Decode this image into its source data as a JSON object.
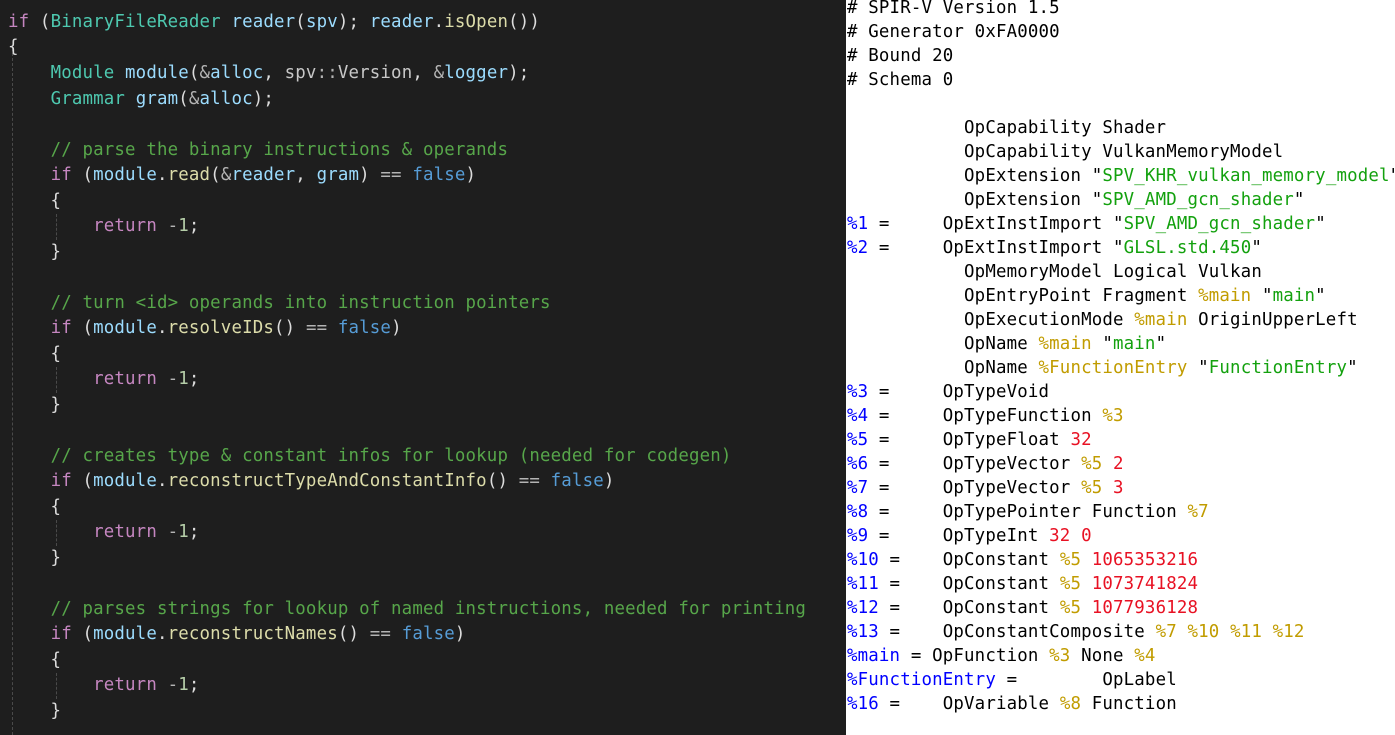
{
  "code_lines": [
    [
      {
        "t": "if",
        "c": "ct"
      },
      {
        "t": " (",
        "c": "pu"
      },
      {
        "t": "BinaryFileReader",
        "c": "ty"
      },
      {
        "t": " ",
        "c": "pu"
      },
      {
        "t": "reader",
        "c": "va"
      },
      {
        "t": "(",
        "c": "pu"
      },
      {
        "t": "spv",
        "c": "va"
      },
      {
        "t": "); ",
        "c": "pu"
      },
      {
        "t": "reader",
        "c": "va"
      },
      {
        "t": ".",
        "c": "pu"
      },
      {
        "t": "isOpen",
        "c": "fn"
      },
      {
        "t": "())",
        "c": "pu"
      }
    ],
    [
      {
        "t": "{",
        "c": "pu"
      }
    ],
    [
      {
        "t": "    ",
        "c": "pu"
      },
      {
        "t": "Module",
        "c": "ty"
      },
      {
        "t": " ",
        "c": "pu"
      },
      {
        "t": "module",
        "c": "va"
      },
      {
        "t": "(",
        "c": "pu"
      },
      {
        "t": "&",
        "c": "op"
      },
      {
        "t": "alloc",
        "c": "va"
      },
      {
        "t": ", ",
        "c": "pu"
      },
      {
        "t": "spv",
        "c": "ns"
      },
      {
        "t": "::",
        "c": "op"
      },
      {
        "t": "Version",
        "c": "ns"
      },
      {
        "t": ", ",
        "c": "pu"
      },
      {
        "t": "&",
        "c": "op"
      },
      {
        "t": "logger",
        "c": "va"
      },
      {
        "t": ");",
        "c": "pu"
      }
    ],
    [
      {
        "t": "    ",
        "c": "pu"
      },
      {
        "t": "Grammar",
        "c": "ty"
      },
      {
        "t": " ",
        "c": "pu"
      },
      {
        "t": "gram",
        "c": "va"
      },
      {
        "t": "(",
        "c": "pu"
      },
      {
        "t": "&",
        "c": "op"
      },
      {
        "t": "alloc",
        "c": "va"
      },
      {
        "t": ");",
        "c": "pu"
      }
    ],
    [],
    [
      {
        "t": "    ",
        "c": "pu"
      },
      {
        "t": "// parse the binary instructions & operands",
        "c": "cm"
      }
    ],
    [
      {
        "t": "    ",
        "c": "pu"
      },
      {
        "t": "if",
        "c": "ct"
      },
      {
        "t": " (",
        "c": "pu"
      },
      {
        "t": "module",
        "c": "va"
      },
      {
        "t": ".",
        "c": "pu"
      },
      {
        "t": "read",
        "c": "fn"
      },
      {
        "t": "(",
        "c": "pu"
      },
      {
        "t": "&",
        "c": "op"
      },
      {
        "t": "reader",
        "c": "va"
      },
      {
        "t": ", ",
        "c": "pu"
      },
      {
        "t": "gram",
        "c": "va"
      },
      {
        "t": ") ",
        "c": "pu"
      },
      {
        "t": "==",
        "c": "op"
      },
      {
        "t": " ",
        "c": "pu"
      },
      {
        "t": "false",
        "c": "kw"
      },
      {
        "t": ")",
        "c": "pu"
      }
    ],
    [
      {
        "t": "    {",
        "c": "pu"
      }
    ],
    [
      {
        "t": "        ",
        "c": "pu"
      },
      {
        "t": "return",
        "c": "ct"
      },
      {
        "t": " ",
        "c": "pu"
      },
      {
        "t": "-",
        "c": "op"
      },
      {
        "t": "1",
        "c": "nu"
      },
      {
        "t": ";",
        "c": "pu"
      }
    ],
    [
      {
        "t": "    }",
        "c": "pu"
      }
    ],
    [],
    [
      {
        "t": "    ",
        "c": "pu"
      },
      {
        "t": "// turn <id> operands into instruction pointers",
        "c": "cm"
      }
    ],
    [
      {
        "t": "    ",
        "c": "pu"
      },
      {
        "t": "if",
        "c": "ct"
      },
      {
        "t": " (",
        "c": "pu"
      },
      {
        "t": "module",
        "c": "va"
      },
      {
        "t": ".",
        "c": "pu"
      },
      {
        "t": "resolveIDs",
        "c": "fn"
      },
      {
        "t": "() ",
        "c": "pu"
      },
      {
        "t": "==",
        "c": "op"
      },
      {
        "t": " ",
        "c": "pu"
      },
      {
        "t": "false",
        "c": "kw"
      },
      {
        "t": ")",
        "c": "pu"
      }
    ],
    [
      {
        "t": "    {",
        "c": "pu"
      }
    ],
    [
      {
        "t": "        ",
        "c": "pu"
      },
      {
        "t": "return",
        "c": "ct"
      },
      {
        "t": " ",
        "c": "pu"
      },
      {
        "t": "-",
        "c": "op"
      },
      {
        "t": "1",
        "c": "nu"
      },
      {
        "t": ";",
        "c": "pu"
      }
    ],
    [
      {
        "t": "    }",
        "c": "pu"
      }
    ],
    [],
    [
      {
        "t": "    ",
        "c": "pu"
      },
      {
        "t": "// creates type & constant infos for lookup (needed for codegen)",
        "c": "cm"
      }
    ],
    [
      {
        "t": "    ",
        "c": "pu"
      },
      {
        "t": "if",
        "c": "ct"
      },
      {
        "t": " (",
        "c": "pu"
      },
      {
        "t": "module",
        "c": "va"
      },
      {
        "t": ".",
        "c": "pu"
      },
      {
        "t": "reconstructTypeAndConstantInfo",
        "c": "fn"
      },
      {
        "t": "() ",
        "c": "pu"
      },
      {
        "t": "==",
        "c": "op"
      },
      {
        "t": " ",
        "c": "pu"
      },
      {
        "t": "false",
        "c": "kw"
      },
      {
        "t": ")",
        "c": "pu"
      }
    ],
    [
      {
        "t": "    {",
        "c": "pu"
      }
    ],
    [
      {
        "t": "        ",
        "c": "pu"
      },
      {
        "t": "return",
        "c": "ct"
      },
      {
        "t": " ",
        "c": "pu"
      },
      {
        "t": "-",
        "c": "op"
      },
      {
        "t": "1",
        "c": "nu"
      },
      {
        "t": ";",
        "c": "pu"
      }
    ],
    [
      {
        "t": "    }",
        "c": "pu"
      }
    ],
    [],
    [
      {
        "t": "    ",
        "c": "pu"
      },
      {
        "t": "// parses strings for lookup of named instructions, needed for printing",
        "c": "cm"
      }
    ],
    [
      {
        "t": "    ",
        "c": "pu"
      },
      {
        "t": "if",
        "c": "ct"
      },
      {
        "t": " (",
        "c": "pu"
      },
      {
        "t": "module",
        "c": "va"
      },
      {
        "t": ".",
        "c": "pu"
      },
      {
        "t": "reconstructNames",
        "c": "fn"
      },
      {
        "t": "() ",
        "c": "pu"
      },
      {
        "t": "==",
        "c": "op"
      },
      {
        "t": " ",
        "c": "pu"
      },
      {
        "t": "false",
        "c": "kw"
      },
      {
        "t": ")",
        "c": "pu"
      }
    ],
    [
      {
        "t": "    {",
        "c": "pu"
      }
    ],
    [
      {
        "t": "        ",
        "c": "pu"
      },
      {
        "t": "return",
        "c": "ct"
      },
      {
        "t": " ",
        "c": "pu"
      },
      {
        "t": "-",
        "c": "op"
      },
      {
        "t": "1",
        "c": "nu"
      },
      {
        "t": ";",
        "c": "pu"
      }
    ],
    [
      {
        "t": "    }",
        "c": "pu"
      }
    ]
  ],
  "disasm_lines": [
    [
      {
        "t": "# SPIR-V Version 1.5"
      }
    ],
    [
      {
        "t": "# Generator 0xFA0000"
      }
    ],
    [
      {
        "t": "# Bound 20"
      }
    ],
    [
      {
        "t": "# Schema 0"
      }
    ],
    [],
    [
      {
        "t": "           OpCapability Shader"
      }
    ],
    [
      {
        "t": "           OpCapability VulkanMemoryModel"
      }
    ],
    [
      {
        "t": "           OpExtension \""
      },
      {
        "t": "SPV_KHR_vulkan_memory_model",
        "c": "str"
      },
      {
        "t": "\""
      }
    ],
    [
      {
        "t": "           OpExtension \""
      },
      {
        "t": "SPV_AMD_gcn_shader",
        "c": "str"
      },
      {
        "t": "\""
      }
    ],
    [
      {
        "t": "%1",
        "c": "res"
      },
      {
        "t": " =     OpExtInstImport \""
      },
      {
        "t": "SPV_AMD_gcn_shader",
        "c": "str"
      },
      {
        "t": "\""
      }
    ],
    [
      {
        "t": "%2",
        "c": "res"
      },
      {
        "t": " =     OpExtInstImport \""
      },
      {
        "t": "GLSL.std.450",
        "c": "str"
      },
      {
        "t": "\""
      }
    ],
    [
      {
        "t": "           OpMemoryModel Logical Vulkan"
      }
    ],
    [
      {
        "t": "           OpEntryPoint Fragment "
      },
      {
        "t": "%main",
        "c": "ref"
      },
      {
        "t": " \""
      },
      {
        "t": "main",
        "c": "str"
      },
      {
        "t": "\""
      }
    ],
    [
      {
        "t": "           OpExecutionMode "
      },
      {
        "t": "%main",
        "c": "ref"
      },
      {
        "t": " OriginUpperLeft"
      }
    ],
    [
      {
        "t": "           OpName "
      },
      {
        "t": "%main",
        "c": "ref"
      },
      {
        "t": " \""
      },
      {
        "t": "main",
        "c": "str"
      },
      {
        "t": "\""
      }
    ],
    [
      {
        "t": "           OpName "
      },
      {
        "t": "%FunctionEntry",
        "c": "ref"
      },
      {
        "t": " \""
      },
      {
        "t": "FunctionEntry",
        "c": "str"
      },
      {
        "t": "\""
      }
    ],
    [
      {
        "t": "%3",
        "c": "res"
      },
      {
        "t": " =     OpTypeVoid"
      }
    ],
    [
      {
        "t": "%4",
        "c": "res"
      },
      {
        "t": " =     OpTypeFunction "
      },
      {
        "t": "%3",
        "c": "ref"
      }
    ],
    [
      {
        "t": "%5",
        "c": "res"
      },
      {
        "t": " =     OpTypeFloat "
      },
      {
        "t": "32",
        "c": "num"
      }
    ],
    [
      {
        "t": "%6",
        "c": "res"
      },
      {
        "t": " =     OpTypeVector "
      },
      {
        "t": "%5",
        "c": "ref"
      },
      {
        "t": " "
      },
      {
        "t": "2",
        "c": "num"
      }
    ],
    [
      {
        "t": "%7",
        "c": "res"
      },
      {
        "t": " =     OpTypeVector "
      },
      {
        "t": "%5",
        "c": "ref"
      },
      {
        "t": " "
      },
      {
        "t": "3",
        "c": "num"
      }
    ],
    [
      {
        "t": "%8",
        "c": "res"
      },
      {
        "t": " =     OpTypePointer Function "
      },
      {
        "t": "%7",
        "c": "ref"
      }
    ],
    [
      {
        "t": "%9",
        "c": "res"
      },
      {
        "t": " =     OpTypeInt "
      },
      {
        "t": "32",
        "c": "num"
      },
      {
        "t": " "
      },
      {
        "t": "0",
        "c": "num"
      }
    ],
    [
      {
        "t": "%10",
        "c": "res"
      },
      {
        "t": " =    OpConstant "
      },
      {
        "t": "%5",
        "c": "ref"
      },
      {
        "t": " "
      },
      {
        "t": "1065353216",
        "c": "num"
      }
    ],
    [
      {
        "t": "%11",
        "c": "res"
      },
      {
        "t": " =    OpConstant "
      },
      {
        "t": "%5",
        "c": "ref"
      },
      {
        "t": " "
      },
      {
        "t": "1073741824",
        "c": "num"
      }
    ],
    [
      {
        "t": "%12",
        "c": "res"
      },
      {
        "t": " =    OpConstant "
      },
      {
        "t": "%5",
        "c": "ref"
      },
      {
        "t": " "
      },
      {
        "t": "1077936128",
        "c": "num"
      }
    ],
    [
      {
        "t": "%13",
        "c": "res"
      },
      {
        "t": " =    OpConstantComposite "
      },
      {
        "t": "%7",
        "c": "ref"
      },
      {
        "t": " "
      },
      {
        "t": "%10",
        "c": "ref"
      },
      {
        "t": " "
      },
      {
        "t": "%11",
        "c": "ref"
      },
      {
        "t": " "
      },
      {
        "t": "%12",
        "c": "ref"
      }
    ],
    [
      {
        "t": "%main",
        "c": "res"
      },
      {
        "t": " = OpFunction "
      },
      {
        "t": "%3",
        "c": "ref"
      },
      {
        "t": " None "
      },
      {
        "t": "%4",
        "c": "ref"
      }
    ],
    [
      {
        "t": "%FunctionEntry",
        "c": "res"
      },
      {
        "t": " =        OpLabel"
      }
    ],
    [
      {
        "t": "%16",
        "c": "res"
      },
      {
        "t": " =    OpVariable "
      },
      {
        "t": "%8",
        "c": "ref"
      },
      {
        "t": " Function"
      }
    ]
  ]
}
